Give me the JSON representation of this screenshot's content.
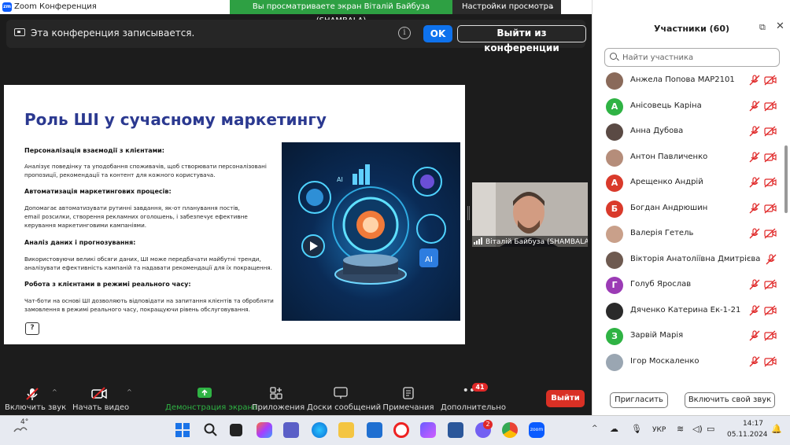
{
  "window": {
    "title": "Zoom Конференция"
  },
  "share_banner": {
    "text": "Вы просматриваете экран Віталій Байбуза (SHAMBALA)",
    "view_options": "Настройки просмотра"
  },
  "recording": {
    "text": "Эта конференция записывается.",
    "ok": "OK",
    "leave_conf": "Выйти из конференции"
  },
  "slide": {
    "title": "Роль ШІ у сучасному маркетингу",
    "sections": [
      {
        "heading": "Персоналізація взаємодії з клієнтами:",
        "lines": [
          "Аналізує поведінку та уподобання споживачів, щоб створювати персоналізовані",
          "пропозиції, рекомендації та контент для кожного користувача."
        ]
      },
      {
        "heading": "Автоматизація маркетингових процесів:",
        "lines": [
          "Допомагає автоматизувати рутинні завдання, як-от планування постів,",
          "email розсилки, створення рекламних оголошень, і забезпечує ефективне",
          "керування маркетинговими кампаніями."
        ]
      },
      {
        "heading": "Аналіз даних і прогнозування:",
        "lines": [
          "Використовуючи великі обсяги даних, ШІ може передбачати майбутні тренди,",
          "аналізувати ефективність кампаній та надавати рекомендації для їх покращення."
        ]
      },
      {
        "heading": "Робота з клієнтами в режимі реального часу:",
        "lines": [
          "Чат-боти на основі ШІ дозволяють відповідати на запитання клієнтів та обробляти",
          "замовлення в режимі реального часу, покращуючи рівень обслуговування."
        ]
      }
    ],
    "image_text": {
      "ai": "AI"
    }
  },
  "video": {
    "name": "Віталій Байбуза (SHAMBALA)"
  },
  "toolbar": {
    "unmute": "Включить звук",
    "start_video": "Начать видео",
    "share": "Демонстрация экрана",
    "apps": "Приложения",
    "whiteboards": "Доски сообщений",
    "notes": "Примечания",
    "more": "Дополнительно",
    "more_badge": "41",
    "leave": "Выйти"
  },
  "participants": {
    "title": "Участники (60)",
    "search_placeholder": "Найти участника",
    "list": [
      {
        "name": "Анжела Попова МАР2101",
        "initial": "",
        "color": "#8a6a5a"
      },
      {
        "name": "Анісовець Каріна",
        "initial": "А",
        "color": "#2fb344"
      },
      {
        "name": "Анна Дубова",
        "initial": "",
        "color": "#5a4a44"
      },
      {
        "name": "Антон Павличенко",
        "initial": "",
        "color": "#b58d7a"
      },
      {
        "name": "Арещенко Андрій",
        "initial": "А",
        "color": "#d93a2b"
      },
      {
        "name": "Богдан Андрюшин",
        "initial": "Б",
        "color": "#d93a2b"
      },
      {
        "name": "Валерія Гетель",
        "initial": "",
        "color": "#c9a08a"
      },
      {
        "name": "Вікторія Анатоліївна Дмитрієва",
        "initial": "",
        "color": "#6e5a50"
      },
      {
        "name": "Голуб Ярослав",
        "initial": "Г",
        "color": "#9b3bb5"
      },
      {
        "name": "Дяченко Катерина Ек-1-21",
        "initial": "",
        "color": "#2a2a2a"
      },
      {
        "name": "Зарвій Марія",
        "initial": "З",
        "color": "#2fb344"
      },
      {
        "name": "Ігор Москаленко",
        "initial": "",
        "color": "#9aa6b2"
      }
    ],
    "invite": "Пригласить",
    "unmute_me": "Включить свой звук"
  },
  "taskbar": {
    "weather": "4°",
    "lang": "УКР",
    "time": "14:17",
    "date": "05.11.2024",
    "teams_badge": "2"
  },
  "colors": {
    "zoom_blue": "#0e72ed",
    "share_green": "#2ea043",
    "leave_red": "#d93025",
    "slide_title": "#2b3990"
  }
}
